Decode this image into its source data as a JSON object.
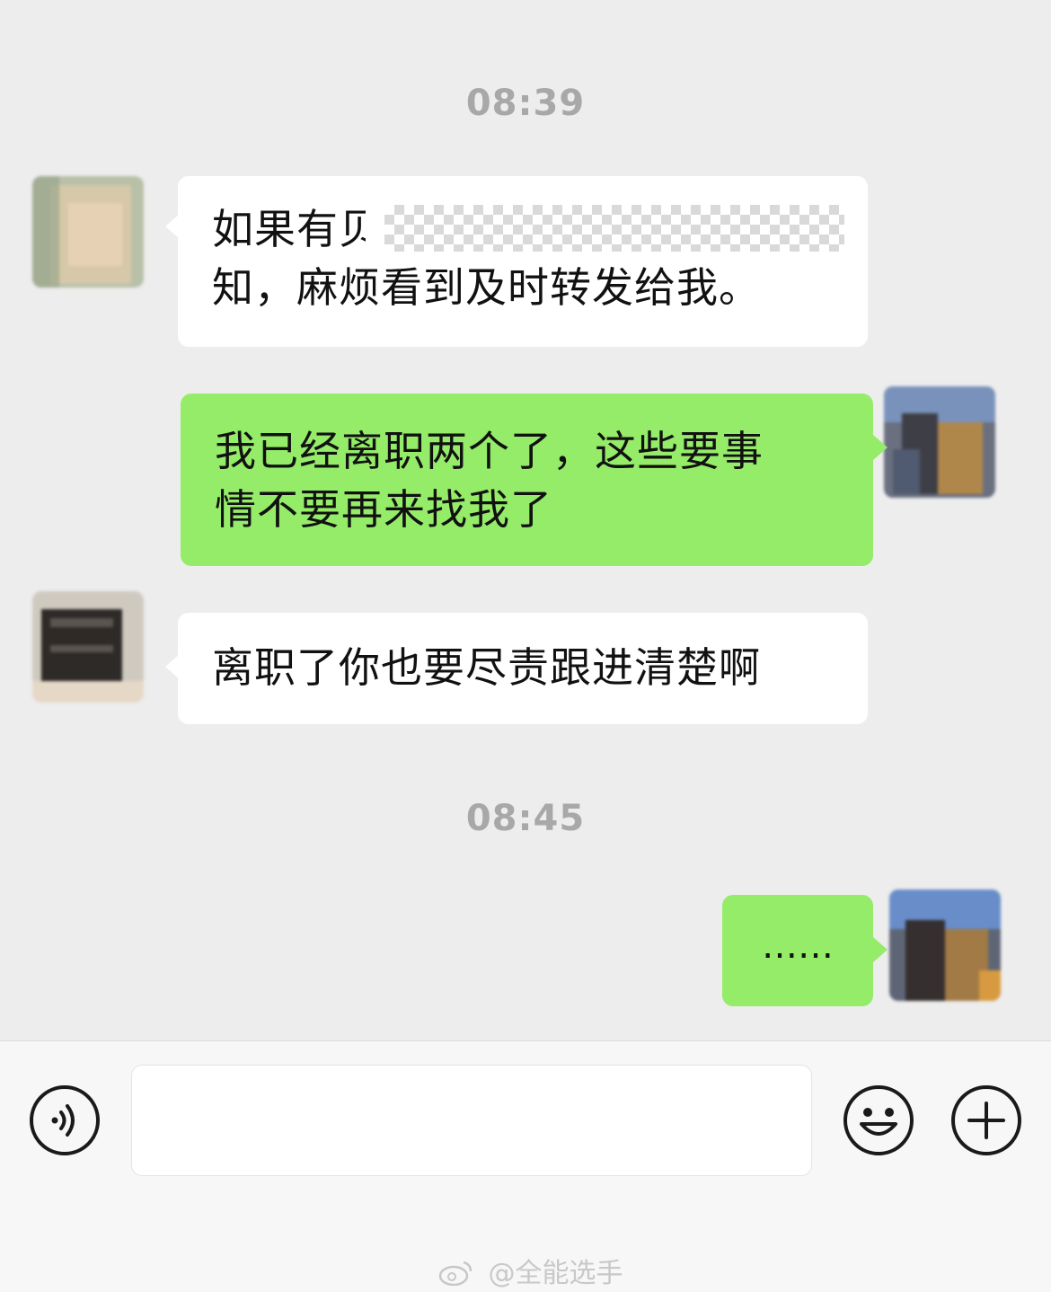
{
  "chat": {
    "timestamps": [
      "08:39",
      "08:45"
    ],
    "messages": [
      {
        "direction": "incoming",
        "line1_visible_start": "如果有",
        "line1_partial_char": "贝",
        "line1_end_partial": "",
        "line2": "知，麻烦看到及时转发给我。",
        "redacted": true
      },
      {
        "direction": "outgoing",
        "line1": "我已经离职两个了，这些要事",
        "line2": "情不要再来找我了"
      },
      {
        "direction": "incoming",
        "line1": "离职了你也要尽责跟进清楚啊"
      },
      {
        "direction": "outgoing",
        "line1": "……"
      }
    ]
  },
  "input_bar": {
    "voice_icon": "voice-wave-icon",
    "emoji_icon": "smiley-face-icon",
    "more_icon": "plus-circle-icon",
    "input_value": ""
  },
  "watermark": {
    "text": "@全能选手",
    "icon": "weibo-logo-icon"
  },
  "colors": {
    "background": "#ededed",
    "incoming_bubble": "#ffffff",
    "outgoing_bubble": "#95ec69",
    "timestamp": "#a8a8a8"
  }
}
